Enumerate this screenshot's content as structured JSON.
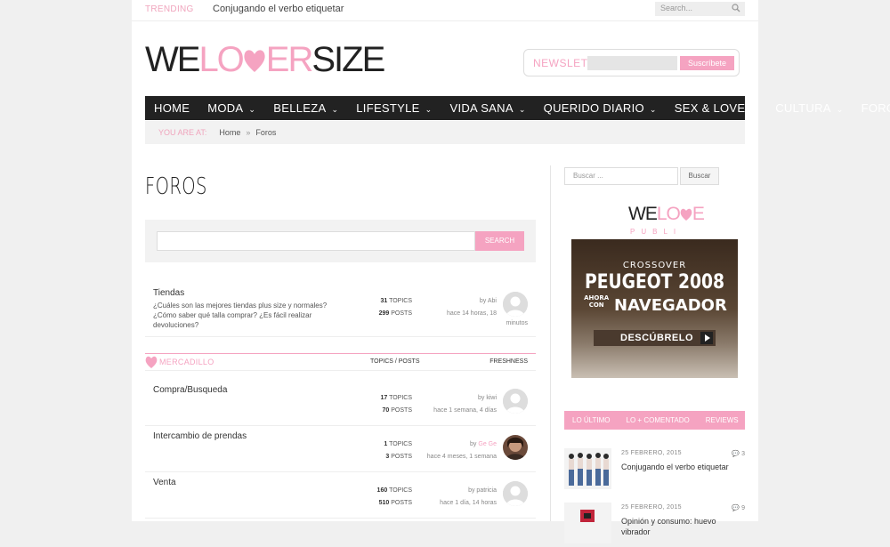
{
  "topbar": {
    "trending_label": "TRENDING",
    "trending_text": "Conjugando el verbo etiquetar",
    "search_placeholder": "Search..."
  },
  "logo": {
    "part1": "WE",
    "part2": "LO",
    "part3": "ER",
    "part4": "SIZE"
  },
  "newsletter": {
    "label": "NEWSLETTER",
    "button": "Suscríbete"
  },
  "nav": [
    {
      "label": "HOME",
      "chevron": ""
    },
    {
      "label": "MODA",
      "chevron": "⌄"
    },
    {
      "label": "BELLEZA",
      "chevron": "⌄"
    },
    {
      "label": "LIFESTYLE",
      "chevron": "⌄"
    },
    {
      "label": "VIDA SANA",
      "chevron": "⌄"
    },
    {
      "label": "QUERIDO DIARIO",
      "chevron": "⌄"
    },
    {
      "label": "SEX & LOVE",
      "chevron": "⌄"
    },
    {
      "label": "CULTURA",
      "chevron": "⌄"
    },
    {
      "label": "FORO",
      "chevron": ""
    }
  ],
  "breadcrumb": {
    "you_are_at": "YOU ARE AT:",
    "home": "Home",
    "sep": "»",
    "current": "Foros"
  },
  "page_title": "FOROS",
  "forum_search": {
    "button": "SEARCH"
  },
  "rows": [
    {
      "name": "Tiendas",
      "desc": "¿Cuáles son las mejores tiendas plus size y normales? ¿Cómo saber qué talla comprar? ¿Es fácil realizar devoluciones?",
      "topics": "31",
      "topics_label": "TOPICS",
      "posts": "299",
      "posts_label": "POSTS",
      "by": "by",
      "user": "Abi",
      "time": "hace 14 horas, 18",
      "extra": "minutos"
    },
    {
      "name": "Compra/Busqueda",
      "desc": "",
      "topics": "17",
      "topics_label": "TOPICS",
      "posts": "70",
      "posts_label": "POSTS",
      "by": "by",
      "user": "kiwi",
      "time": "hace 1 semana, 4 días",
      "extra": ""
    },
    {
      "name": "Intercambio de prendas",
      "desc": "",
      "topics": "1",
      "topics_label": "TOPICS",
      "posts": "3",
      "posts_label": "POSTS",
      "by": "by",
      "user": "Ge Ge",
      "time": "hace 4 meses, 1 semana",
      "extra": ""
    },
    {
      "name": "Venta",
      "desc": "",
      "topics": "160",
      "topics_label": "TOPICS",
      "posts": "510",
      "posts_label": "POSTS",
      "by": "by",
      "user": "patricia",
      "time": "hace 1 día, 14 horas",
      "extra": ""
    }
  ],
  "category": {
    "name": "MERCADILLO",
    "topics_posts": "TOPICS / POSTS",
    "freshness": "FRESHNESS"
  },
  "sidebar": {
    "search_placeholder": "Buscar ...",
    "search_button": "Buscar",
    "publi_logo_a": "WE",
    "publi_logo_b": "LO",
    "publi_logo_c": "E",
    "publi_sub": "PUBLI",
    "ad": {
      "line1": "CROSSOVER",
      "line2": "PEUGEOT 2008",
      "line3a": "AHORA CON",
      "line3b": "NAVEGADOR",
      "cta": "DESCÚBRELO"
    },
    "tabs": [
      "LO ÚLTIMO",
      "LO + COMENTADO",
      "REVIEWS"
    ],
    "posts": [
      {
        "date": "25 FEBRERO, 2015",
        "comments": "3",
        "title": "Conjugando el verbo etiquetar"
      },
      {
        "date": "25 FEBRERO, 2015",
        "comments": "9",
        "title": "Opinión y consumo: huevo vibrador"
      }
    ]
  },
  "colors": {
    "pink": "#f5a3c1",
    "nav_bg": "#222222"
  }
}
